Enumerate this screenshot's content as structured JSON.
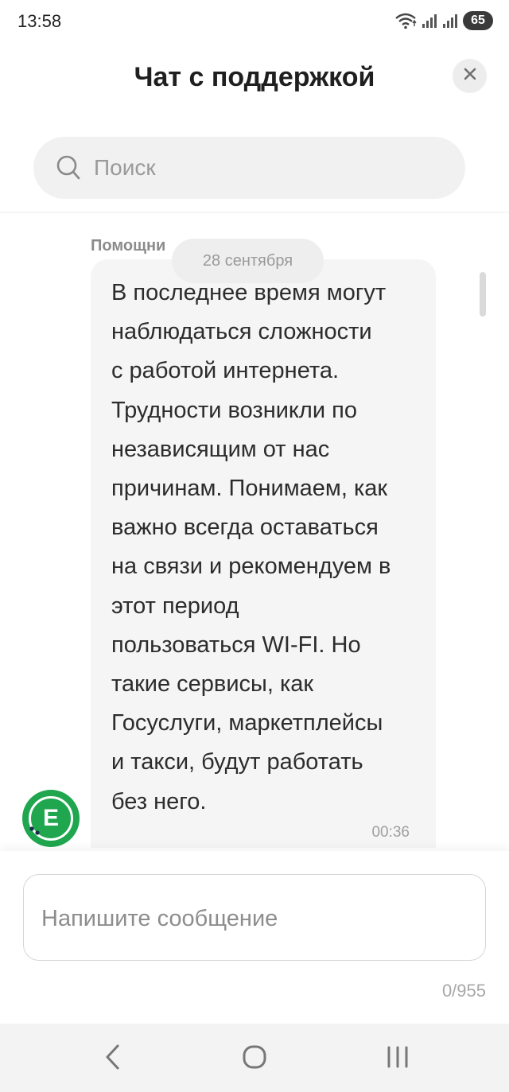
{
  "status_bar": {
    "time": "13:58",
    "battery": "65",
    "icons": [
      "wifi-icon",
      "signal-icon",
      "signal-icon",
      "battery-icon"
    ]
  },
  "header": {
    "title": "Чат с поддержкой",
    "close_icon": "close-icon"
  },
  "search": {
    "placeholder": "Поиск",
    "icon": "search-icon"
  },
  "chat": {
    "date": "28 сентября",
    "sender": "Помощни",
    "message": {
      "text": "В последнее время могут\nнаблюдаться сложности\nс работой интернета.\nТрудности возникли по\nнезависящим от нас\nпричинам. Понимаем, как\nважно всегда оставаться\nна связи и рекомендуем в\nэтот период\nпользоваться WI-FI. Но\nтакие сервисы, как\nГосуслуги, маркетплейсы\nи такси, будут работать\nбез него.",
      "time": "00:36"
    },
    "avatar_letter": "Е",
    "avatar_color": "#1fa64e"
  },
  "composer": {
    "placeholder": "Напишите сообщение",
    "counter": "0/955"
  },
  "nav_bar": {
    "icons": [
      "back-icon",
      "home-icon",
      "recents-icon"
    ]
  }
}
